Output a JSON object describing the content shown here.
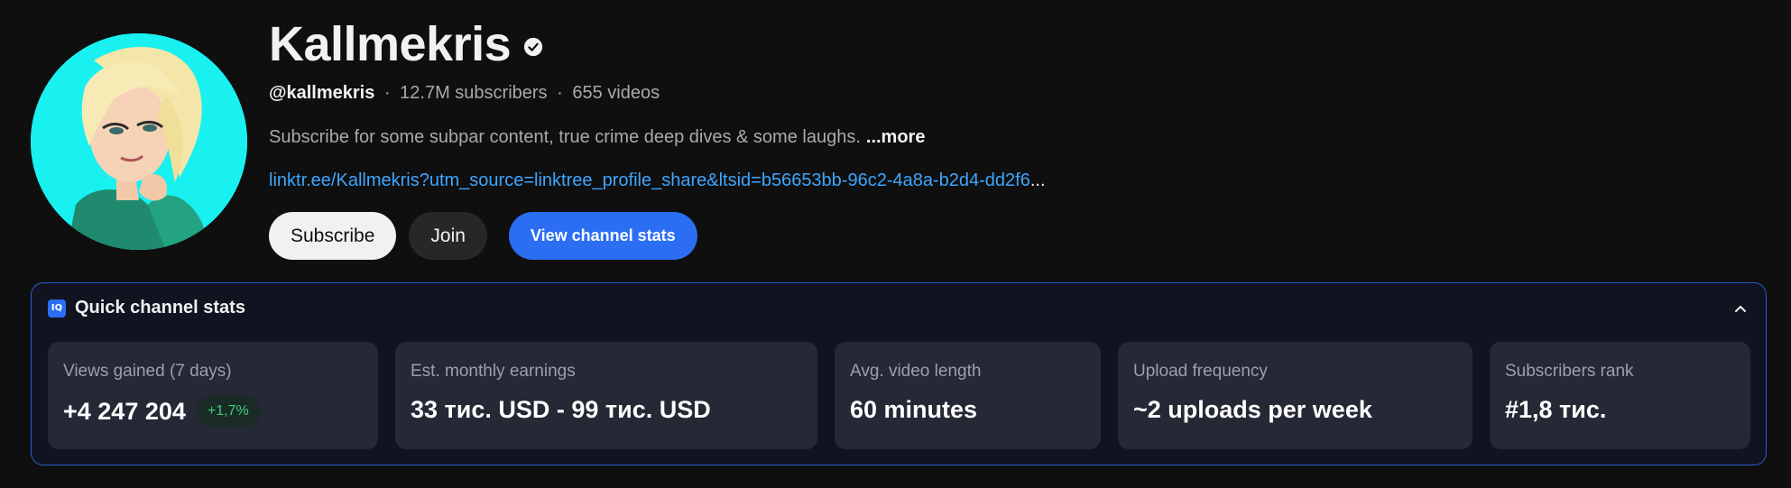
{
  "channel": {
    "name": "Kallmekris",
    "handle": "@kallmekris",
    "subscribers": "12.7M subscribers",
    "videos": "655 videos",
    "separator": "·",
    "description": "Subscribe for some subpar content, true crime deep dives & some laughs.",
    "more_label": "...more",
    "link": "linktr.ee/Kallmekris?utm_source=linktree_profile_share&ltsid=b56653bb-96c2-4a8a-b2d4-dd2f6",
    "link_ellipsis": "..."
  },
  "buttons": {
    "subscribe": "Subscribe",
    "join": "Join",
    "view_stats": "View channel stats"
  },
  "stats_panel": {
    "icon_label": "IQ",
    "title": "Quick channel stats",
    "cards": [
      {
        "label": "Views gained (7 days)",
        "value": "+4 247 204",
        "badge": "+1,7%"
      },
      {
        "label": "Est. monthly earnings",
        "value": "33 тис. USD - 99 тис. USD"
      },
      {
        "label": "Avg. video length",
        "value": "60 minutes"
      },
      {
        "label": "Upload frequency",
        "value": "~2 uploads per week"
      },
      {
        "label": "Subscribers rank",
        "value": "#1,8 тис."
      }
    ]
  },
  "colors": {
    "background": "#0f0f0f",
    "accent_blue": "#2b6ef2",
    "link_blue": "#3ea6ff",
    "positive_green": "#3ccf7a",
    "avatar_bg": "#19f0f0"
  },
  "icons": [
    "verified-icon",
    "iq-logo-icon",
    "chevron-up-icon"
  ]
}
